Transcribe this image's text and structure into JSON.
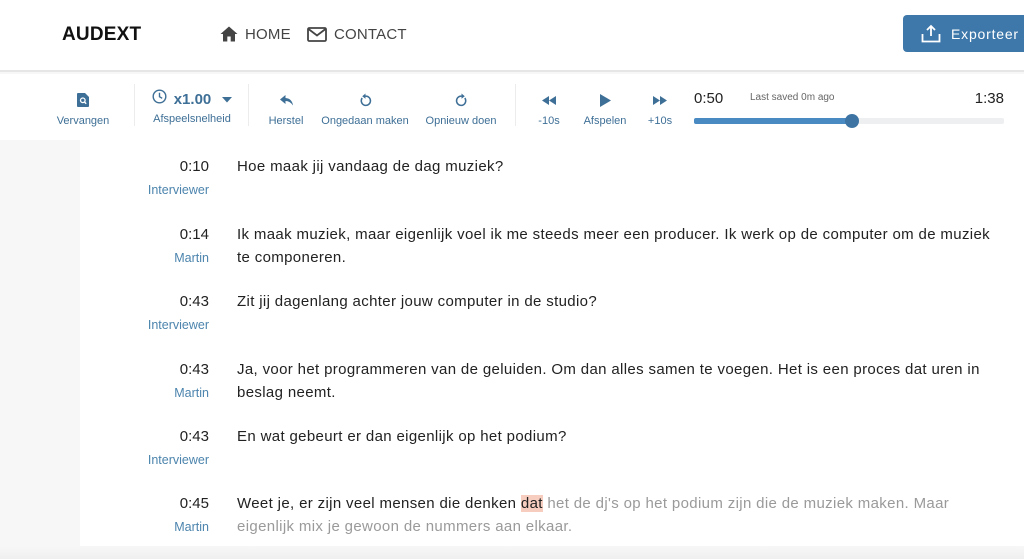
{
  "header": {
    "logo": "AUDEXT",
    "nav": [
      {
        "label": "HOME",
        "icon": "home-icon"
      },
      {
        "label": "CONTACT",
        "icon": "mail-icon"
      }
    ],
    "export_button": {
      "label": "Exporteer",
      "icon": "upload-icon"
    }
  },
  "toolbar": {
    "replace": {
      "label": "Vervangen",
      "icon": "find-replace-icon"
    },
    "speed": {
      "value": "x1.00",
      "label": "Afspeelsnelheid",
      "icon": "clock-icon"
    },
    "restore": {
      "label": "Herstel",
      "icon": "reply-icon"
    },
    "undo": {
      "label": "Ongedaan maken",
      "icon": "undo-icon"
    },
    "redo": {
      "label": "Opnieuw doen",
      "icon": "redo-icon"
    },
    "rewind": {
      "label": "-10s",
      "icon": "rewind-icon"
    },
    "play": {
      "label": "Afspelen",
      "icon": "play-icon"
    },
    "forward": {
      "label": "+10s",
      "icon": "fast-forward-icon"
    }
  },
  "player": {
    "current_time": "0:50",
    "duration": "1:38",
    "saved_status": "Last saved 0m ago",
    "progress_fraction": 0.51
  },
  "colors": {
    "accent": "#3e78aa",
    "label_blue": "#3e6f96",
    "speaker_blue": "#4c84ad",
    "highlight": "#f6cdbf"
  },
  "transcript": [
    {
      "time": "0:10",
      "speaker": "Interviewer",
      "text": "Hoe maak jij vandaag de dag muziek?"
    },
    {
      "time": "0:14",
      "speaker": "Martin",
      "text": "Ik maak muziek, maar eigenlijk voel ik me steeds meer een producer. Ik werk op de computer om de muziek te componeren."
    },
    {
      "time": "0:43",
      "speaker": "Interviewer",
      "text": "Zit jij dagenlang achter jouw computer in de studio?"
    },
    {
      "time": "0:43",
      "speaker": "Martin",
      "text": "Ja, voor het programmeren van de geluiden. Om dan alles samen te voegen. Het is een proces dat uren in beslag neemt."
    },
    {
      "time": "0:43",
      "speaker": "Interviewer",
      "text": "En wat gebeurt er dan eigenlijk op het podium?"
    },
    {
      "time": "0:45",
      "speaker": "Martin",
      "text_played": "Weet je, er zijn veel mensen die denken ",
      "text_current": "dat",
      "text_upcoming": " het de dj's op het podium zijn die de muziek maken. Maar eigenlijk mix je gewoon de nummers aan elkaar."
    }
  ]
}
